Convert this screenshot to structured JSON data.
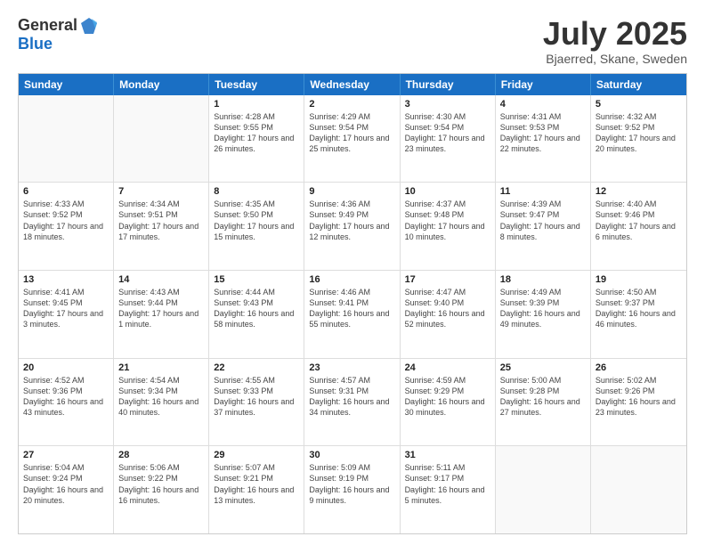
{
  "logo": {
    "general": "General",
    "blue": "Blue"
  },
  "header": {
    "month": "July 2025",
    "location": "Bjaerred, Skane, Sweden"
  },
  "weekdays": [
    "Sunday",
    "Monday",
    "Tuesday",
    "Wednesday",
    "Thursday",
    "Friday",
    "Saturday"
  ],
  "weeks": [
    [
      {
        "day": "",
        "empty": true
      },
      {
        "day": "",
        "empty": true
      },
      {
        "day": "1",
        "sunrise": "Sunrise: 4:28 AM",
        "sunset": "Sunset: 9:55 PM",
        "daylight": "Daylight: 17 hours and 26 minutes."
      },
      {
        "day": "2",
        "sunrise": "Sunrise: 4:29 AM",
        "sunset": "Sunset: 9:54 PM",
        "daylight": "Daylight: 17 hours and 25 minutes."
      },
      {
        "day": "3",
        "sunrise": "Sunrise: 4:30 AM",
        "sunset": "Sunset: 9:54 PM",
        "daylight": "Daylight: 17 hours and 23 minutes."
      },
      {
        "day": "4",
        "sunrise": "Sunrise: 4:31 AM",
        "sunset": "Sunset: 9:53 PM",
        "daylight": "Daylight: 17 hours and 22 minutes."
      },
      {
        "day": "5",
        "sunrise": "Sunrise: 4:32 AM",
        "sunset": "Sunset: 9:52 PM",
        "daylight": "Daylight: 17 hours and 20 minutes."
      }
    ],
    [
      {
        "day": "6",
        "sunrise": "Sunrise: 4:33 AM",
        "sunset": "Sunset: 9:52 PM",
        "daylight": "Daylight: 17 hours and 18 minutes."
      },
      {
        "day": "7",
        "sunrise": "Sunrise: 4:34 AM",
        "sunset": "Sunset: 9:51 PM",
        "daylight": "Daylight: 17 hours and 17 minutes."
      },
      {
        "day": "8",
        "sunrise": "Sunrise: 4:35 AM",
        "sunset": "Sunset: 9:50 PM",
        "daylight": "Daylight: 17 hours and 15 minutes."
      },
      {
        "day": "9",
        "sunrise": "Sunrise: 4:36 AM",
        "sunset": "Sunset: 9:49 PM",
        "daylight": "Daylight: 17 hours and 12 minutes."
      },
      {
        "day": "10",
        "sunrise": "Sunrise: 4:37 AM",
        "sunset": "Sunset: 9:48 PM",
        "daylight": "Daylight: 17 hours and 10 minutes."
      },
      {
        "day": "11",
        "sunrise": "Sunrise: 4:39 AM",
        "sunset": "Sunset: 9:47 PM",
        "daylight": "Daylight: 17 hours and 8 minutes."
      },
      {
        "day": "12",
        "sunrise": "Sunrise: 4:40 AM",
        "sunset": "Sunset: 9:46 PM",
        "daylight": "Daylight: 17 hours and 6 minutes."
      }
    ],
    [
      {
        "day": "13",
        "sunrise": "Sunrise: 4:41 AM",
        "sunset": "Sunset: 9:45 PM",
        "daylight": "Daylight: 17 hours and 3 minutes."
      },
      {
        "day": "14",
        "sunrise": "Sunrise: 4:43 AM",
        "sunset": "Sunset: 9:44 PM",
        "daylight": "Daylight: 17 hours and 1 minute."
      },
      {
        "day": "15",
        "sunrise": "Sunrise: 4:44 AM",
        "sunset": "Sunset: 9:43 PM",
        "daylight": "Daylight: 16 hours and 58 minutes."
      },
      {
        "day": "16",
        "sunrise": "Sunrise: 4:46 AM",
        "sunset": "Sunset: 9:41 PM",
        "daylight": "Daylight: 16 hours and 55 minutes."
      },
      {
        "day": "17",
        "sunrise": "Sunrise: 4:47 AM",
        "sunset": "Sunset: 9:40 PM",
        "daylight": "Daylight: 16 hours and 52 minutes."
      },
      {
        "day": "18",
        "sunrise": "Sunrise: 4:49 AM",
        "sunset": "Sunset: 9:39 PM",
        "daylight": "Daylight: 16 hours and 49 minutes."
      },
      {
        "day": "19",
        "sunrise": "Sunrise: 4:50 AM",
        "sunset": "Sunset: 9:37 PM",
        "daylight": "Daylight: 16 hours and 46 minutes."
      }
    ],
    [
      {
        "day": "20",
        "sunrise": "Sunrise: 4:52 AM",
        "sunset": "Sunset: 9:36 PM",
        "daylight": "Daylight: 16 hours and 43 minutes."
      },
      {
        "day": "21",
        "sunrise": "Sunrise: 4:54 AM",
        "sunset": "Sunset: 9:34 PM",
        "daylight": "Daylight: 16 hours and 40 minutes."
      },
      {
        "day": "22",
        "sunrise": "Sunrise: 4:55 AM",
        "sunset": "Sunset: 9:33 PM",
        "daylight": "Daylight: 16 hours and 37 minutes."
      },
      {
        "day": "23",
        "sunrise": "Sunrise: 4:57 AM",
        "sunset": "Sunset: 9:31 PM",
        "daylight": "Daylight: 16 hours and 34 minutes."
      },
      {
        "day": "24",
        "sunrise": "Sunrise: 4:59 AM",
        "sunset": "Sunset: 9:29 PM",
        "daylight": "Daylight: 16 hours and 30 minutes."
      },
      {
        "day": "25",
        "sunrise": "Sunrise: 5:00 AM",
        "sunset": "Sunset: 9:28 PM",
        "daylight": "Daylight: 16 hours and 27 minutes."
      },
      {
        "day": "26",
        "sunrise": "Sunrise: 5:02 AM",
        "sunset": "Sunset: 9:26 PM",
        "daylight": "Daylight: 16 hours and 23 minutes."
      }
    ],
    [
      {
        "day": "27",
        "sunrise": "Sunrise: 5:04 AM",
        "sunset": "Sunset: 9:24 PM",
        "daylight": "Daylight: 16 hours and 20 minutes."
      },
      {
        "day": "28",
        "sunrise": "Sunrise: 5:06 AM",
        "sunset": "Sunset: 9:22 PM",
        "daylight": "Daylight: 16 hours and 16 minutes."
      },
      {
        "day": "29",
        "sunrise": "Sunrise: 5:07 AM",
        "sunset": "Sunset: 9:21 PM",
        "daylight": "Daylight: 16 hours and 13 minutes."
      },
      {
        "day": "30",
        "sunrise": "Sunrise: 5:09 AM",
        "sunset": "Sunset: 9:19 PM",
        "daylight": "Daylight: 16 hours and 9 minutes."
      },
      {
        "day": "31",
        "sunrise": "Sunrise: 5:11 AM",
        "sunset": "Sunset: 9:17 PM",
        "daylight": "Daylight: 16 hours and 5 minutes."
      },
      {
        "day": "",
        "empty": true
      },
      {
        "day": "",
        "empty": true
      }
    ]
  ]
}
